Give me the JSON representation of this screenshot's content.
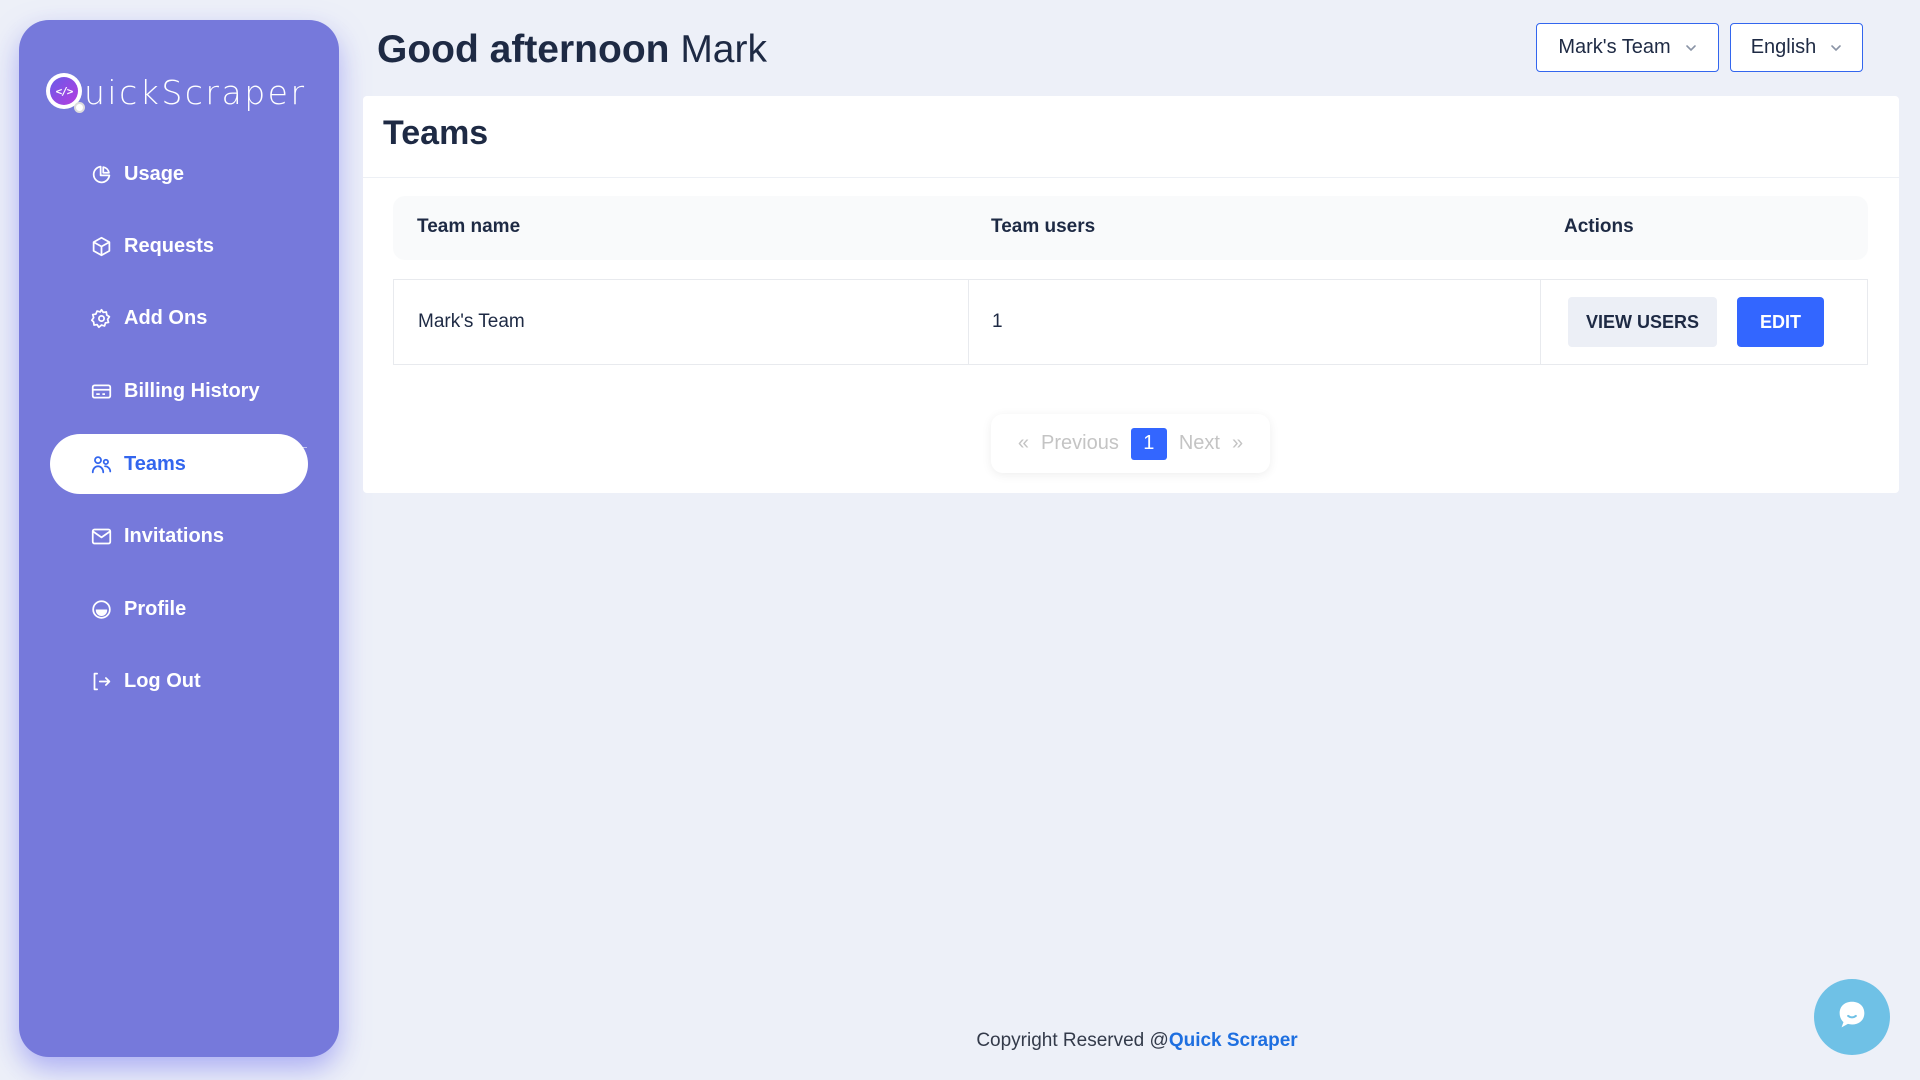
{
  "brand": {
    "name": "uickScraper",
    "logo_letter": "Q"
  },
  "sidebar": {
    "items": [
      {
        "label": "Usage",
        "icon": "pie-chart-icon",
        "active": false
      },
      {
        "label": "Requests",
        "icon": "cube-icon",
        "active": false
      },
      {
        "label": "Add Ons",
        "icon": "gear-icon",
        "active": false
      },
      {
        "label": "Billing History",
        "icon": "credit-card-icon",
        "active": false
      },
      {
        "label": "Teams",
        "icon": "users-icon",
        "active": true
      },
      {
        "label": "Invitations",
        "icon": "mail-icon",
        "active": false
      },
      {
        "label": "Profile",
        "icon": "smile-icon",
        "active": false
      },
      {
        "label": "Log Out",
        "icon": "logout-icon",
        "active": false
      }
    ]
  },
  "header": {
    "greeting": "Good afternoon",
    "user_name": "Mark",
    "team_select": {
      "value": "Mark's Team"
    },
    "language_select": {
      "value": "English"
    }
  },
  "teams_card": {
    "title": "Teams",
    "columns": [
      "Team name",
      "Team users",
      "Actions"
    ],
    "rows": [
      {
        "team_name": "Mark's Team",
        "team_users": "1",
        "actions": [
          "VIEW USERS",
          "EDIT"
        ]
      }
    ],
    "pagination": {
      "first": "«",
      "previous": "Previous",
      "current": "1",
      "next": "Next",
      "last": "»"
    }
  },
  "footer": {
    "text": "Copyright Reserved @",
    "link": "Quick Scraper"
  },
  "colors": {
    "sidebar": "#7679db",
    "accent": "#3366ff",
    "background": "#edf0f8",
    "chat": "#6fc1e6"
  }
}
